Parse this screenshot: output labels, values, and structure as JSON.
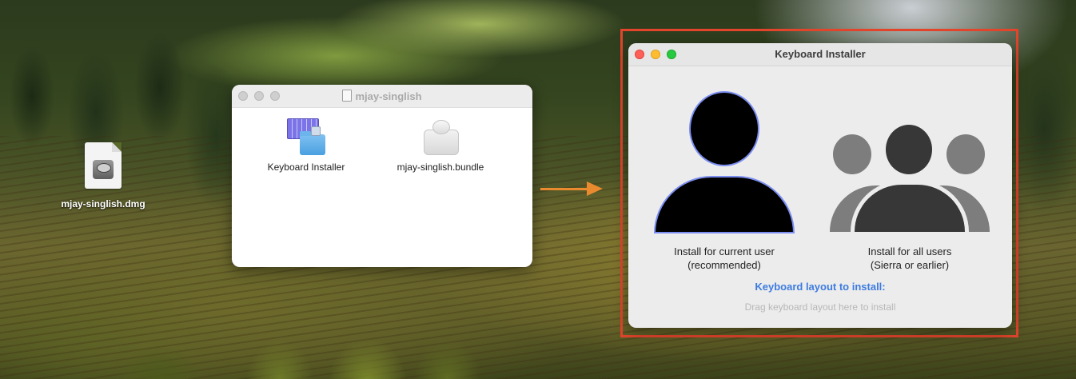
{
  "desktop": {
    "file_icon": {
      "icon": "disk-image-icon",
      "label": "mjay-singlish.dmg"
    }
  },
  "finder_window": {
    "title": "mjay-singlish",
    "items": [
      {
        "label": "Keyboard Installer",
        "icon": "keyboard-installer-app-icon"
      },
      {
        "label": "mjay-singlish.bundle",
        "icon": "bundle-plugin-icon"
      }
    ]
  },
  "installer_window": {
    "title": "Keyboard Installer",
    "current_user_option": {
      "line1": "Install for current user",
      "line2": "(recommended)"
    },
    "all_users_option": {
      "line1": "Install for all users",
      "line2": "(Sierra or earlier)"
    },
    "layout_label": "Keyboard layout to install:",
    "drag_hint": "Drag keyboard layout here to install"
  },
  "annotation": {
    "arrow_color": "#e98a2f",
    "highlight_color": "#e2452c"
  },
  "colors": {
    "link_blue": "#3d7be0",
    "selection_outline": "#7b8df0"
  }
}
